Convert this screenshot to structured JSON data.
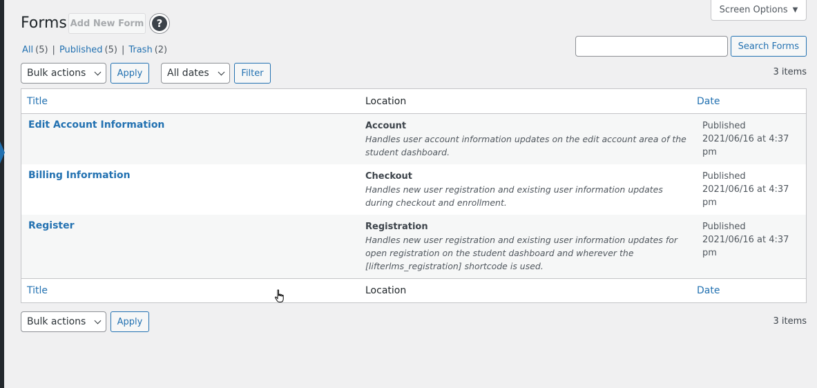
{
  "screen_options": {
    "label": "Screen Options",
    "caret": "▼"
  },
  "header": {
    "title": "Forms",
    "add_new_label": "Add New Form",
    "help_glyph": "?"
  },
  "filters": {
    "all": {
      "label": "All",
      "count": "(5)"
    },
    "published": {
      "label": "Published",
      "count": "(5)"
    },
    "trash": {
      "label": "Trash",
      "count": "(2)"
    },
    "separator": "|"
  },
  "search": {
    "button_label": "Search Forms",
    "value": ""
  },
  "tablenav": {
    "bulk_actions": "Bulk actions",
    "apply": "Apply",
    "dates": "All dates",
    "filter": "Filter",
    "items_count": "3 items"
  },
  "table": {
    "columns": {
      "title": "Title",
      "location": "Location",
      "date": "Date"
    },
    "rows": [
      {
        "title": "Edit Account Information",
        "location_name": "Account",
        "location_desc": "Handles user account information updates on the edit account area of the student dashboard.",
        "status": "Published",
        "date": "2021/06/16 at 4:37 pm"
      },
      {
        "title": "Billing Information",
        "location_name": "Checkout",
        "location_desc": "Handles new user registration and existing user information updates during checkout and enrollment.",
        "status": "Published",
        "date": "2021/06/16 at 4:37 pm"
      },
      {
        "title": "Register",
        "location_name": "Registration",
        "location_desc": "Handles new user registration and existing user information updates for open registration on the student dashboard and wherever the [lifterlms_registration] shortcode is used.",
        "status": "Published",
        "date": "2021/06/16 at 4:37 pm"
      }
    ]
  },
  "colors": {
    "link": "#2271b1",
    "background": "#f0f0f1",
    "alt_row": "#f6f7f7"
  }
}
